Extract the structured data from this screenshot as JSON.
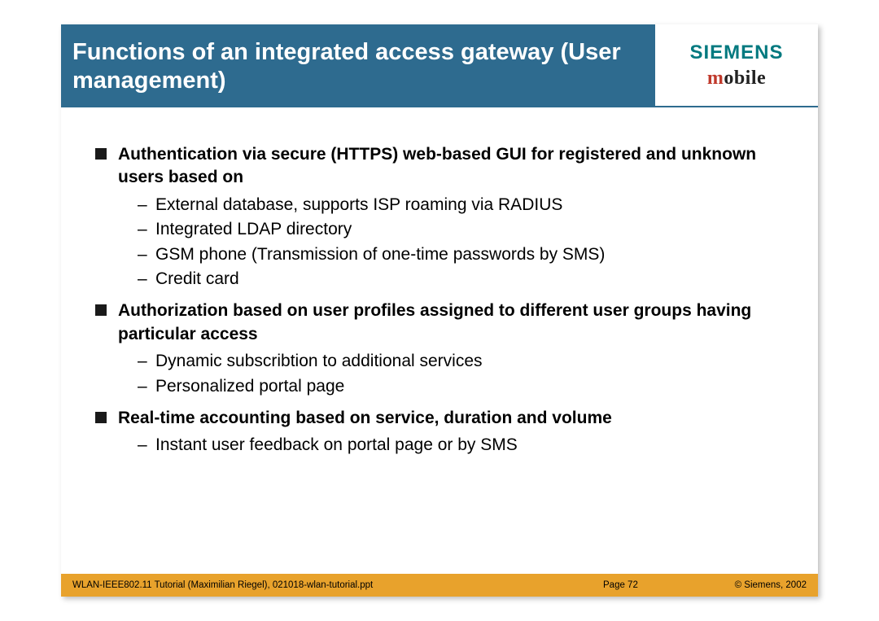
{
  "header": {
    "title": "Functions of an integrated access gateway (User management)",
    "logo_main": "SIEMENS",
    "logo_sub_m": "m",
    "logo_sub_rest": "obile"
  },
  "bullets": [
    {
      "head": "Authentication via secure (HTTPS) web-based GUI for registered and unknown users based on",
      "sub": [
        "External database, supports ISP roaming via RADIUS",
        "Integrated LDAP directory",
        "GSM phone (Transmission of one-time passwords by SMS)",
        "Credit card"
      ]
    },
    {
      "head": "Authorization based on user profiles assigned to different user groups having particular access",
      "sub": [
        "Dynamic subscribtion to additional services",
        "Personalized portal page"
      ]
    },
    {
      "head": "Real-time accounting based on service, duration and volume",
      "sub": [
        "Instant user feedback on portal page  or by SMS"
      ]
    }
  ],
  "footer": {
    "left": "WLAN-IEEE802.11 Tutorial (Maximilian Riegel), 021018-wlan-tutorial.ppt",
    "page": "Page 72",
    "right": "© Siemens, 2002"
  }
}
